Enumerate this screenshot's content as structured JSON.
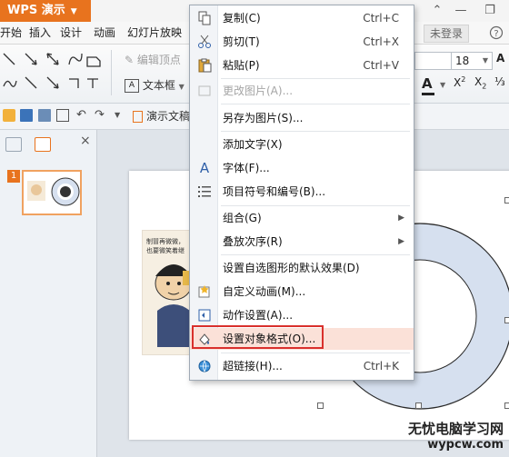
{
  "app": {
    "title": "WPS 演示",
    "login": "未登录"
  },
  "menubar": {
    "items": [
      "开始",
      "插入",
      "设计",
      "动画",
      "幻灯片放映"
    ]
  },
  "ribbon": {
    "edit_vertex": "编辑顶点",
    "textbox": "文本框",
    "font_size": "18",
    "change_picture": "更改图片(A)..."
  },
  "doc_tab": "演示文稿",
  "thumbnail": {
    "number": "1"
  },
  "context_menu": {
    "items": [
      {
        "label": "复制(C)",
        "shortcut": "Ctrl+C"
      },
      {
        "label": "剪切(T)",
        "shortcut": "Ctrl+X"
      },
      {
        "label": "粘贴(P)",
        "shortcut": "Ctrl+V"
      },
      {
        "label": "更改图片(A)..."
      },
      {
        "label": "另存为图片(S)..."
      },
      {
        "label": "添加文字(X)"
      },
      {
        "label": "字体(F)..."
      },
      {
        "label": "项目符号和编号(B)..."
      },
      {
        "label": "组合(G)"
      },
      {
        "label": "叠放次序(R)"
      },
      {
        "label": "设置自选图形的默认效果(D)"
      },
      {
        "label": "自定义动画(M)..."
      },
      {
        "label": "动作设置(A)..."
      },
      {
        "label": "设置对象格式(O)..."
      },
      {
        "label": "超链接(H)...",
        "shortcut": "Ctrl+K"
      }
    ]
  },
  "slide": {
    "caption_line1": "制冒再微微，",
    "caption_line2": "也要微笑着继"
  },
  "watermark": {
    "line1": "无忧电脑学习网",
    "line2": "wypcw.com"
  },
  "colors": {
    "accent": "#e8731e",
    "highlight": "#d9302c",
    "selected_bg": "#fbe1d8",
    "circle_fill": "#d6e0ef"
  }
}
